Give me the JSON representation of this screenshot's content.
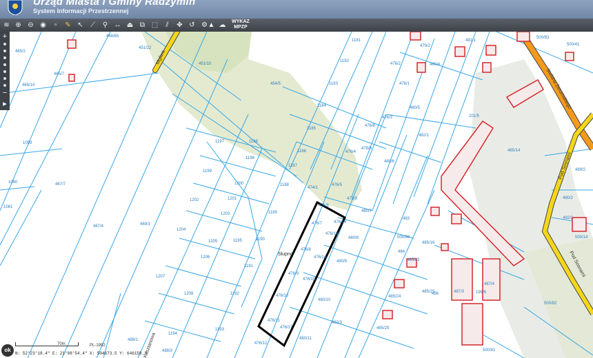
{
  "header": {
    "title": "Urząd Miasta i Gminy Radzymin",
    "subtitle": "System Informacji Przestrzennej"
  },
  "toolbar": {
    "wykaz_line1": "WYKAZ",
    "wykaz_line2": "MPZP",
    "icons": [
      "layers-icon",
      "zoom-in-icon",
      "zoom-out-icon",
      "full-extent-icon",
      "pencil-icon",
      "pointer-icon",
      "measure-line-icon",
      "link-icon",
      "pan-icon",
      "print-icon",
      "copy-icon",
      "export-icon",
      "hatch-icon",
      "move-icon",
      "undo-icon",
      "weather-icon",
      "settings-icon",
      "share-icon",
      "poll-icon"
    ]
  },
  "sidebar": {
    "plus": "+",
    "minus": "−",
    "play": "▸"
  },
  "footer": {
    "ok": "ok",
    "scale_label": "70m",
    "projection": "PL-1992",
    "coordinates": "N: 52°23'18.4\"  E: 21°08'54.4\"  X: 504673.5  Y: 646159.3"
  },
  "colors": {
    "parcel": "#39a7e6",
    "road": "#f5d61a",
    "road_orange": "#f39a1c",
    "building": "#d6262c",
    "forest": "#e4ead0",
    "selection": "#000000"
  },
  "map": {
    "streets": [
      "Mgliwa",
      "Stefana Żeromskiego",
      "Pod Sosnami",
      "Pod Sosnami",
      "Kasztanowa"
    ],
    "place": "Słupno",
    "parcels": [
      "465/2",
      "448/65",
      "451/22",
      "451/10",
      "465/7",
      "465/14",
      "454/5",
      "1059",
      "1060",
      "1061",
      "467/7",
      "467/4",
      "469/1",
      "1181",
      "1182",
      "1183",
      "1184",
      "1185",
      "1186",
      "1187",
      "1188",
      "1189",
      "1190",
      "1191",
      "1192",
      "1193",
      "1194",
      "1195",
      "1196",
      "1197",
      "1198",
      "1199",
      "1200",
      "1201",
      "1202",
      "1203",
      "1204",
      "1205",
      "1206",
      "1207",
      "1208",
      "476/2",
      "476/3",
      "476/4",
      "476/5",
      "476/6",
      "476/7",
      "476/8",
      "476/9",
      "476/10",
      "476/11",
      "476/12",
      "476/13",
      "476/14",
      "476/15",
      "476/16",
      "476/17",
      "474/1",
      "476/8",
      "478/8",
      "478/9",
      "478/1",
      "479/2",
      "480/4",
      "480/5",
      "480/6",
      "480/7",
      "480/8",
      "480/9",
      "480/10",
      "480/11",
      "481/1",
      "482/1",
      "482/3",
      "483",
      "484",
      "485/16",
      "485/23",
      "485/24",
      "485/25",
      "485/14",
      "485/15",
      "486",
      "487/3",
      "487/4",
      "488/1",
      "488/3",
      "489/2",
      "490/2",
      "492/2",
      "500/14",
      "500/81",
      "500/82",
      "500/83",
      "500/41",
      "500/96",
      "199/6",
      "201/5",
      "485/6",
      "487/1",
      "485/5"
    ]
  }
}
